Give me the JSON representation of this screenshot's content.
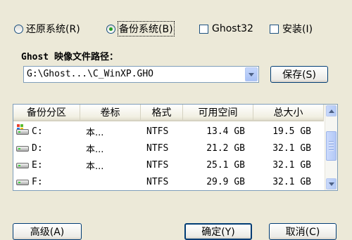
{
  "options": {
    "restore": "还原系统(R)",
    "backup": "备份系统(B)",
    "ghost32": "Ghost32",
    "install": "安装(I)"
  },
  "path_section": {
    "label": "Ghost 映像文件路径：",
    "value": "G:\\Ghost...\\C_WinXP.GHO",
    "save_button": "保存(S)"
  },
  "table": {
    "headers": [
      "备份分区",
      "卷标",
      "格式",
      "可用空间",
      "总大小"
    ],
    "rows": [
      {
        "partition": "C:",
        "label": "本...",
        "format": "NTFS",
        "free": "13.4 GB",
        "total": "19.5 GB"
      },
      {
        "partition": "D:",
        "label": "本...",
        "format": "NTFS",
        "free": "21.2 GB",
        "total": "32.1 GB"
      },
      {
        "partition": "E:",
        "label": "本...",
        "format": "NTFS",
        "free": "25.1 GB",
        "total": "32.1 GB"
      },
      {
        "partition": "F:",
        "label": "",
        "format": "NTFS",
        "free": "29.9 GB",
        "total": "32.1 GB"
      }
    ]
  },
  "bottom_buttons": {
    "advanced": "高级(A)",
    "ok": "确定(Y)",
    "cancel": "取消(C)"
  },
  "icons": {
    "dropdown": "chevron-down-icon",
    "drive": "hard-drive-icon",
    "system_drive": "windows-drive-icon"
  },
  "colors": {
    "window_bg": "#ece9d8",
    "border": "#7f9db9",
    "radio_dot": "#21a121"
  }
}
